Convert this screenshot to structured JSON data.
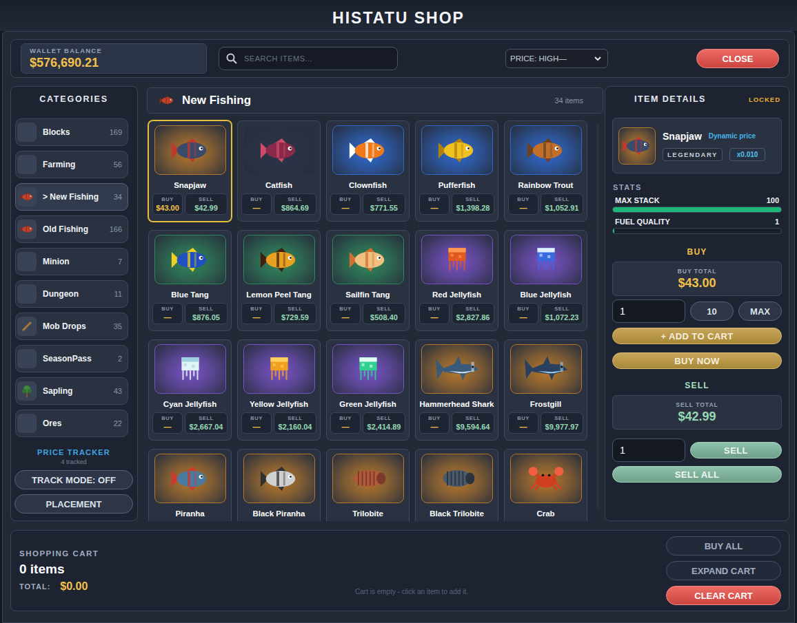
{
  "window": {
    "title": "HISTATU SHOP"
  },
  "topbar": {
    "wallet_label": "WALLET BALANCE",
    "wallet_value": "$576,690.21",
    "search": {
      "placeholder": "SEARCH ITEMS..."
    },
    "sort": "PRICE: HIGH—",
    "close": "CLOSE"
  },
  "categories": {
    "title": "CATEGORIES",
    "items": [
      {
        "label": "Blocks",
        "count": "169",
        "selected": false,
        "kind": "blank"
      },
      {
        "label": "Farming",
        "count": "56",
        "selected": false,
        "kind": "blank"
      },
      {
        "label": "> New Fishing",
        "count": "34",
        "selected": true,
        "kind": "fish"
      },
      {
        "label": "Old Fishing",
        "count": "166",
        "selected": false,
        "kind": "fish"
      },
      {
        "label": "Minion",
        "count": "7",
        "selected": false,
        "kind": "blank"
      },
      {
        "label": "Dungeon",
        "count": "11",
        "selected": false,
        "kind": "blank"
      },
      {
        "label": "Mob Drops",
        "count": "35",
        "selected": false,
        "kind": "stick"
      },
      {
        "label": "SeasonPass",
        "count": "2",
        "selected": false,
        "kind": "blank"
      },
      {
        "label": "Sapling",
        "count": "43",
        "selected": false,
        "kind": "sapling"
      },
      {
        "label": "Ores",
        "count": "22",
        "selected": false,
        "kind": "blank"
      }
    ],
    "tracker": {
      "title": "PRICE TRACKER",
      "count": "4 tracked",
      "buttons": [
        "TRACK MODE: OFF",
        "PLACEMENT"
      ]
    }
  },
  "grid": {
    "title": "New Fishing",
    "count": "34 items",
    "buy_label": "BUY",
    "sell_label": "SELL",
    "items": [
      {
        "name": "Snapjaw",
        "buy": "$43.00",
        "sell": "$42.99",
        "selected": true,
        "color": "#b8782a",
        "kind": "fish"
      },
      {
        "name": "Catfish",
        "buy": "—",
        "sell": "$864.69",
        "selected": false,
        "color": "#2a3246",
        "kind": "fish"
      },
      {
        "name": "Clownfish",
        "buy": "—",
        "sell": "$771.55",
        "selected": false,
        "color": "#2e6ad0",
        "kind": "fish"
      },
      {
        "name": "Pufferfish",
        "buy": "—",
        "sell": "$1,398.28",
        "selected": false,
        "color": "#2e6ad0",
        "kind": "fish"
      },
      {
        "name": "Rainbow Trout",
        "buy": "—",
        "sell": "$1,052.91",
        "selected": false,
        "color": "#2e6ad0",
        "kind": "fish"
      },
      {
        "name": "Blue Tang",
        "buy": "—",
        "sell": "$876.05",
        "selected": false,
        "color": "#2f8a5a",
        "kind": "fish"
      },
      {
        "name": "Lemon Peel Tang",
        "buy": "—",
        "sell": "$729.59",
        "selected": false,
        "color": "#2f8a5a",
        "kind": "fish"
      },
      {
        "name": "Sailfin Tang",
        "buy": "—",
        "sell": "$508.40",
        "selected": false,
        "color": "#2f8a5a",
        "kind": "fish"
      },
      {
        "name": "Red Jellyfish",
        "buy": "—",
        "sell": "$2,827.86",
        "selected": false,
        "color": "#7a52c8",
        "kind": "jellyfish"
      },
      {
        "name": "Blue Jellyfish",
        "buy": "—",
        "sell": "$1,072.23",
        "selected": false,
        "color": "#7a52c8",
        "kind": "jellyfish"
      },
      {
        "name": "Cyan Jellyfish",
        "buy": "—",
        "sell": "$2,667.04",
        "selected": false,
        "color": "#7a52c8",
        "kind": "jellyfish"
      },
      {
        "name": "Yellow Jellyfish",
        "buy": "—",
        "sell": "$2,160.04",
        "selected": false,
        "color": "#7a52c8",
        "kind": "jellyfish"
      },
      {
        "name": "Green Jellyfish",
        "buy": "—",
        "sell": "$2,414.89",
        "selected": false,
        "color": "#7a52c8",
        "kind": "jellyfish"
      },
      {
        "name": "Hammerhead Shark",
        "buy": "—",
        "sell": "$9,594.64",
        "selected": false,
        "color": "#b8782a",
        "kind": "shark"
      },
      {
        "name": "Frostgill",
        "buy": "—",
        "sell": "$9,977.97",
        "selected": false,
        "color": "#b8782a",
        "kind": "shark"
      },
      {
        "name": "Piranha",
        "selected": false,
        "color": "#b8782a",
        "kind": "fish"
      },
      {
        "name": "Black Piranha",
        "selected": false,
        "color": "#b8782a",
        "kind": "fish"
      },
      {
        "name": "Trilobite",
        "selected": false,
        "color": "#b8782a",
        "kind": "trilobite"
      },
      {
        "name": "Black Trilobite",
        "selected": false,
        "color": "#b8782a",
        "kind": "trilobite"
      },
      {
        "name": "Crab",
        "selected": false,
        "color": "#b8782a",
        "kind": "crab"
      }
    ]
  },
  "details": {
    "title": "ITEM DETAILS",
    "lock": "LOCKED",
    "item": {
      "name": "Snapjaw",
      "price_mode": "Dynamic price",
      "rarity": "LEGENDARY",
      "multiplier": "x0.010",
      "color": "#b8782a",
      "kind": "fish"
    },
    "stats_title": "STATS",
    "stats": [
      {
        "label": "MAX STACK",
        "value": "100",
        "level": 1
      },
      {
        "label": "FUEL QUALITY",
        "value": "1",
        "level": 0.01
      }
    ],
    "buy": {
      "title": "BUY",
      "total_label": "BUY TOTAL",
      "total": "$43.00",
      "quantity": "1",
      "buttons": [
        "10",
        "MAX"
      ],
      "add": "+ ADD TO CART",
      "now": "BUY NOW"
    },
    "sell": {
      "title": "SELL",
      "total_label": "SELL TOTAL",
      "total": "$42.99",
      "quantity": "1",
      "button": "SELL",
      "all": "SELL ALL"
    }
  },
  "cart": {
    "title": "SHOPPING CART",
    "count": "0 items",
    "total_label": "TOTAL:",
    "total": "$0.00",
    "empty": "Cart is empty - click an item to add it.",
    "buttons": [
      {
        "label": "BUY ALL",
        "kind": "plain"
      },
      {
        "label": "EXPAND CART",
        "kind": "plain"
      },
      {
        "label": "CLEAR CART",
        "kind": "danger"
      }
    ]
  }
}
